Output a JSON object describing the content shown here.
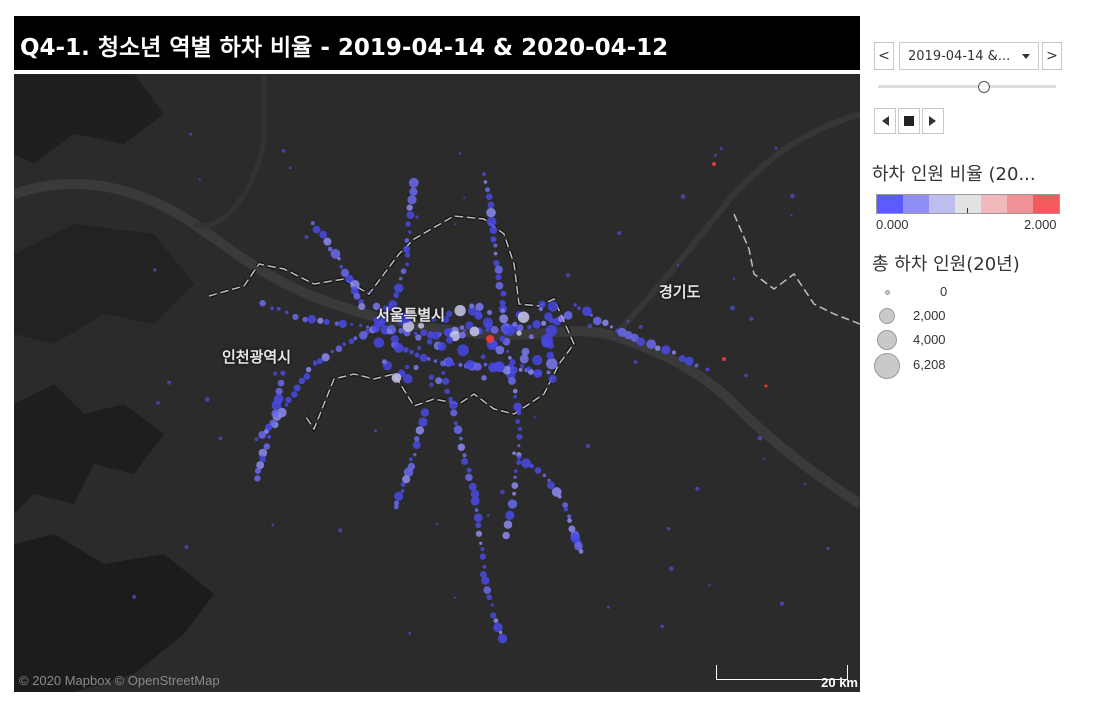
{
  "title": "Q4-1. 청소년 역별 하차 비율 - 2019-04-14 & 2020-04-12",
  "map": {
    "labels": {
      "seoul": "서울특별시",
      "incheon": "인천광역시",
      "gyeonggi": "경기도"
    },
    "attribution": "© 2020 Mapbox © OpenStreetMap",
    "scale_label": "20 km"
  },
  "controls": {
    "prev_label": "<",
    "next_label": ">",
    "date_value": "2019-04-14 &...",
    "slider_position": 0.59
  },
  "color_legend": {
    "title": "하차 인원 비율 (20...",
    "min_label": "0.000",
    "max_label": "2.000",
    "colors": [
      "#5b5bff",
      "#8e8ef5",
      "#bdbdf0",
      "#e2e2e2",
      "#f1b9bb",
      "#f29097",
      "#f55a5f"
    ]
  },
  "size_legend": {
    "title": "총 하차 인원(20년)",
    "items": [
      {
        "label": "0",
        "value": 0
      },
      {
        "label": "2,000",
        "value": 2000
      },
      {
        "label": "4,000",
        "value": 4000
      },
      {
        "label": "6,208",
        "value": 6208
      }
    ]
  }
}
